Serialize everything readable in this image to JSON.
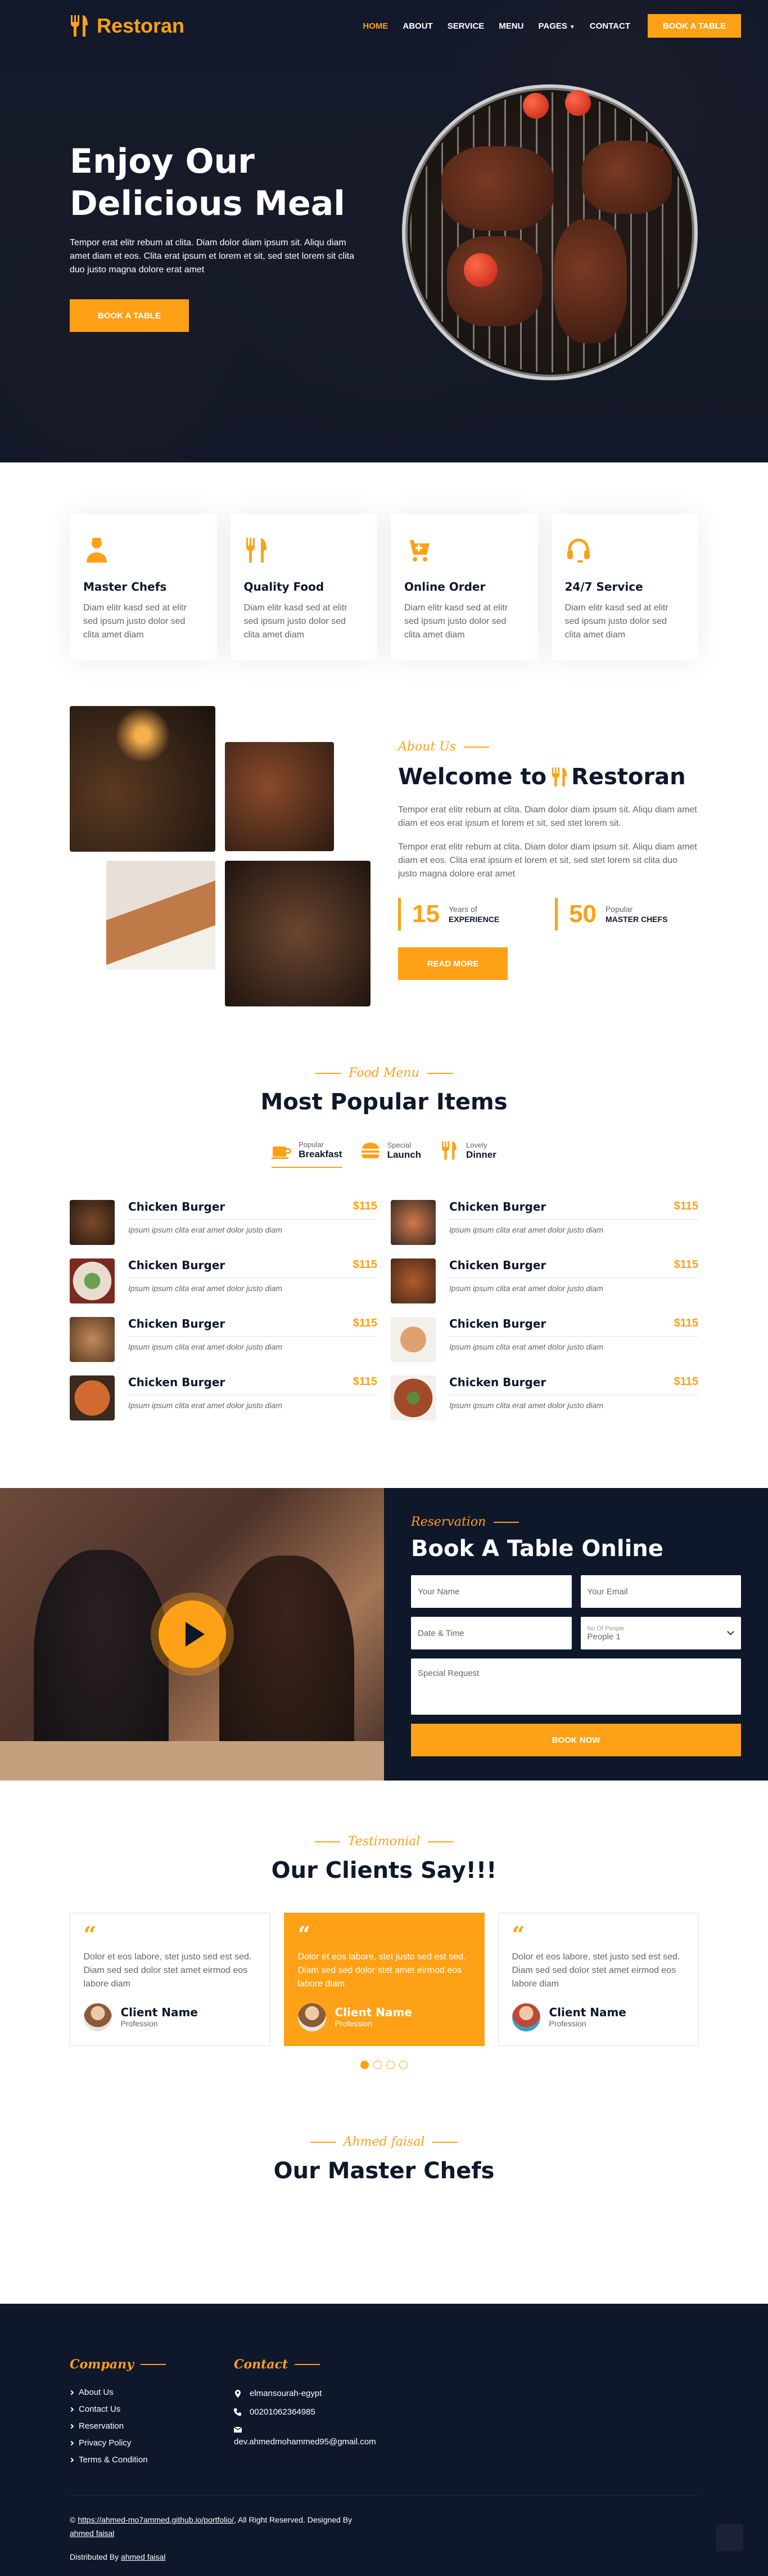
{
  "brand": {
    "name": "Restoran"
  },
  "nav": {
    "items": [
      "Home",
      "About",
      "Service",
      "Menu",
      "Pages",
      "Contact"
    ],
    "cta": "Book A Table"
  },
  "hero": {
    "title_line1": "Enjoy Our",
    "title_line2": "Delicious Meal",
    "text": "Tempor erat elitr rebum at clita. Diam dolor diam ipsum sit. Aliqu diam amet diam et eos. Clita erat ipsum et lorem et sit, sed stet lorem sit clita duo justo magna dolore erat amet",
    "button": "Book A Table"
  },
  "services": [
    {
      "icon": "chef-icon",
      "title": "Master Chefs",
      "text": "Diam elitr kasd sed at elitr sed ipsum justo dolor sed clita amet diam"
    },
    {
      "icon": "utensils-icon",
      "title": "Quality Food",
      "text": "Diam elitr kasd sed at elitr sed ipsum justo dolor sed clita amet diam"
    },
    {
      "icon": "cart-icon",
      "title": "Online Order",
      "text": "Diam elitr kasd sed at elitr sed ipsum justo dolor sed clita amet diam"
    },
    {
      "icon": "headset-icon",
      "title": "24/7 Service",
      "text": "Diam elitr kasd sed at elitr sed ipsum justo dolor sed clita amet diam"
    }
  ],
  "about": {
    "tag": "About Us",
    "title_prefix": "Welcome to",
    "title_brand": "Restoran",
    "p1": "Tempor erat elitr rebum at clita. Diam dolor diam ipsum sit. Aliqu diam amet diam et eos erat ipsum et lorem et sit, sed stet lorem sit.",
    "p2": "Tempor erat elitr rebum at clita. Diam dolor diam ipsum sit. Aliqu diam amet diam et eos. Clita erat ipsum et lorem et sit, sed stet lorem sit clita duo justo magna dolore erat amet",
    "stat1_num": "15",
    "stat1_small": "Years of",
    "stat1_label": "Experience",
    "stat2_num": "50",
    "stat2_small": "Popular",
    "stat2_label": "Master Chefs",
    "button": "Read More"
  },
  "menu": {
    "tag": "Food Menu",
    "title": "Most Popular Items",
    "tabs": [
      {
        "small": "Popular",
        "label": "Breakfast"
      },
      {
        "small": "Special",
        "label": "Launch"
      },
      {
        "small": "Lovely",
        "label": "Dinner"
      }
    ],
    "items": [
      {
        "name": "Chicken Burger",
        "price": "$115",
        "desc": "Ipsum ipsum clita erat amet dolor justo diam"
      },
      {
        "name": "Chicken Burger",
        "price": "$115",
        "desc": "Ipsum ipsum clita erat amet dolor justo diam"
      },
      {
        "name": "Chicken Burger",
        "price": "$115",
        "desc": "Ipsum ipsum clita erat amet dolor justo diam"
      },
      {
        "name": "Chicken Burger",
        "price": "$115",
        "desc": "Ipsum ipsum clita erat amet dolor justo diam"
      },
      {
        "name": "Chicken Burger",
        "price": "$115",
        "desc": "Ipsum ipsum clita erat amet dolor justo diam"
      },
      {
        "name": "Chicken Burger",
        "price": "$115",
        "desc": "Ipsum ipsum clita erat amet dolor justo diam"
      },
      {
        "name": "Chicken Burger",
        "price": "$115",
        "desc": "Ipsum ipsum clita erat amet dolor justo diam"
      },
      {
        "name": "Chicken Burger",
        "price": "$115",
        "desc": "Ipsum ipsum clita erat amet dolor justo diam"
      }
    ]
  },
  "reservation": {
    "tag": "Reservation",
    "title": "Book A Table Online",
    "name_placeholder": "Your Name",
    "email_placeholder": "Your Email",
    "datetime_placeholder": "Date & Time",
    "people_label": "No Of People",
    "people_value": "People 1",
    "request_placeholder": "Special Request",
    "button": "Book Now"
  },
  "testimonial": {
    "tag": "Testimonial",
    "title": "Our Clients Say!!!",
    "cards": [
      {
        "text": "Dolor et eos labore, stet justo sed est sed. Diam sed sed dolor stet amet eirmod eos labore diam",
        "name": "Client Name",
        "role": "Profession"
      },
      {
        "text": "Dolor et eos labore, stet justo sed est sed. Diam sed sed dolor stet amet eirmod eos labore diam",
        "name": "Client Name",
        "role": "Profession"
      },
      {
        "text": "Dolor et eos labore, stet justo sed est sed. Diam sed sed dolor stet amet eirmod eos labore diam",
        "name": "Client Name",
        "role": "Profession"
      }
    ]
  },
  "chefs": {
    "tag": "Ahmed faisal",
    "title": "Our Master Chefs"
  },
  "footer": {
    "company_title": "Company",
    "links": [
      "About Us",
      "Contact Us",
      "Reservation",
      "Privacy Policy",
      "Terms & Condition"
    ],
    "contact_title": "Contact",
    "address": "elmansourah-egypt",
    "phone": "00201062364985",
    "email": "dev.ahmedmohammed95@gmail.com",
    "copy_prefix": "©",
    "copy_link": "https://ahmed-mo7ammed.github.io/portfolio/",
    "copy_mid": ", All Right Reserved. Designed By",
    "copy_author": "ahmed faisal",
    "dist_prefix": "Distributed By",
    "dist_author": "ahmed faisal"
  },
  "colors": {
    "accent": "#FEA116",
    "dark": "#0F172B"
  }
}
